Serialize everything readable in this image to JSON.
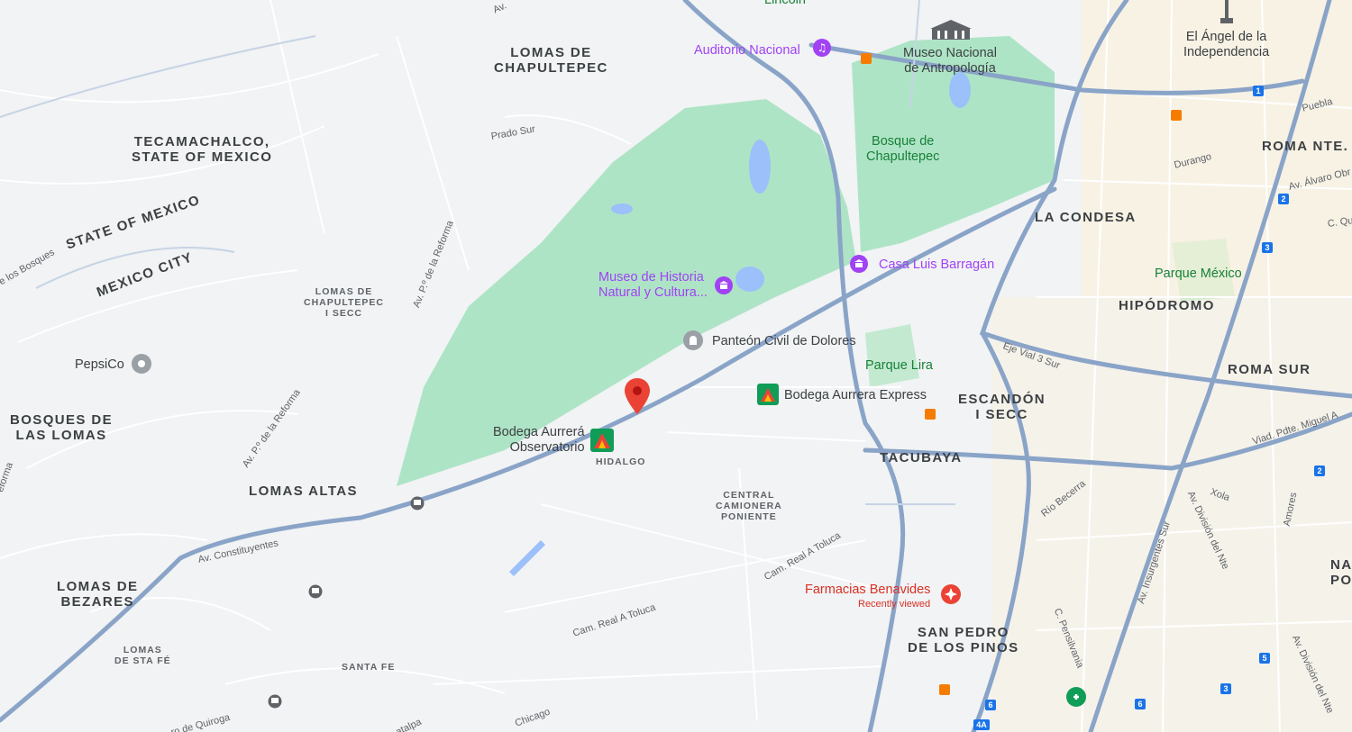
{
  "map": {
    "areas": {
      "lomas_chapultepec": "LOMAS DE\nCHAPULTEPEC",
      "tecamachalco": "TECAMACHALCO,\nSTATE OF MEXICO",
      "state_of_mexico": "STATE OF MEXICO",
      "mexico_city": "MEXICO CITY",
      "lomas_chap_i_secc": "LOMAS DE\nCHAPULTEPEC\nI SECC",
      "bosques_lomas": "BOSQUES DE\nLAS LOMAS",
      "lomas_altas": "LOMAS ALTAS",
      "lomas_bezares": "LOMAS DE\nBEZARES",
      "lomas_sta_fe": "LOMAS\nDE STA FÉ",
      "santa_fe": "SANTA FE",
      "hidalgo": "HIDALGO",
      "central_camionera": "CENTRAL\nCAMIONERA\nPONIENTE",
      "tacubaya": "TACUBAYA",
      "escandon": "ESCANDÓN\nI SECC",
      "la_condesa": "LA CONDESA",
      "hipodromo": "HIPÓDROMO",
      "roma_nte": "ROMA NTE.",
      "roma_sur": "ROMA SUR",
      "san_pedro": "SAN PEDRO\nDE LOS PINOS",
      "napo": "NA\nPO"
    },
    "pois": {
      "lincoln": "Lincoln",
      "auditorio": "Auditorio Nacional",
      "museo_antropologia": "Museo Nacional\nde Antropología",
      "angel": "El Ángel de la\nIndependencia",
      "bosque": "Bosque de\nChapultepec",
      "casa_barragan": "Casa Luis Barragán",
      "museo_historia": "Museo de Historia\nNatural y Cultura...",
      "panteon": "Panteón Civil de Dolores",
      "parque_lira": "Parque Lira",
      "bodega_express": "Bodega Aurrera Express",
      "bodega_obs": "Bodega Aurrerá\nObservatorio",
      "pepsico": "PepsiCo",
      "parque_mexico": "Parque México",
      "benavides": "Farmacias Benavides",
      "recently_viewed": "Recently viewed"
    },
    "streets": {
      "prado_sur": "Prado Sur",
      "reforma1": "Av. P.º de la Reforma",
      "reforma2": "Av. P.º de la Reforma",
      "los_bosques": "e los Bosques",
      "constituyentes": "Av. Constituyentes",
      "eje_vial": "Eje Vial 3 Sur",
      "rio_becerra": "Río Becerra",
      "cam_real_toluca1": "Cam. Real A Toluca",
      "cam_real_toluca2": "Cam. Real A Toluca",
      "chicago": "Chicago",
      "quiroga": "ro de Quiroga",
      "atalpa": "atalpa",
      "durango": "Durango",
      "puebla": "Puebla",
      "alvaro": "Av. Álvaro Obr",
      "c_qu": "C. Qu",
      "viad_miguel": "Viad. Pdte. Miguel A",
      "insurgentes": "Av. Insurgentes Sur",
      "division1": "Av. División del Nte",
      "division2": "Av. División del Nte",
      "xola": "Xola",
      "amores": "Amores",
      "pensilvania": "C. Pensilvania",
      "reforma_left": "eforma",
      "av_top": "Av."
    },
    "badges": [
      "1",
      "2",
      "3",
      "2",
      "5",
      "3",
      "6",
      "6",
      "4A"
    ]
  }
}
